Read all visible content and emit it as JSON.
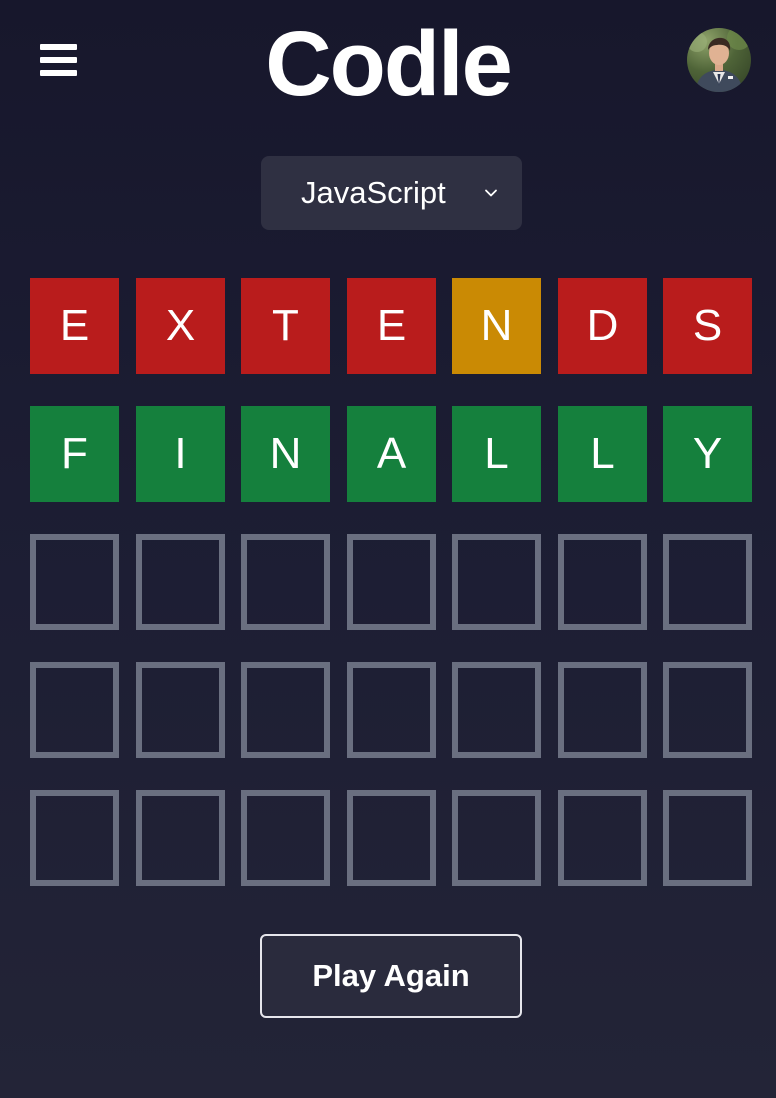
{
  "header": {
    "title": "Codle",
    "menu_icon": "hamburger-menu-icon",
    "avatar_icon": "user-avatar"
  },
  "language_select": {
    "selected": "JavaScript",
    "icon": "chevron-down-icon"
  },
  "colors": {
    "absent": "#b91c1c",
    "present": "#ca8a04",
    "correct": "#15803d",
    "empty_border": "#6a6f80"
  },
  "board": {
    "rows": [
      {
        "status": "guessed",
        "tiles": [
          {
            "letter": "E",
            "state": "absent"
          },
          {
            "letter": "X",
            "state": "absent"
          },
          {
            "letter": "T",
            "state": "absent"
          },
          {
            "letter": "E",
            "state": "absent"
          },
          {
            "letter": "N",
            "state": "present"
          },
          {
            "letter": "D",
            "state": "absent"
          },
          {
            "letter": "S",
            "state": "absent"
          }
        ]
      },
      {
        "status": "guessed",
        "tiles": [
          {
            "letter": "F",
            "state": "correct"
          },
          {
            "letter": "I",
            "state": "correct"
          },
          {
            "letter": "N",
            "state": "correct"
          },
          {
            "letter": "A",
            "state": "correct"
          },
          {
            "letter": "L",
            "state": "correct"
          },
          {
            "letter": "L",
            "state": "correct"
          },
          {
            "letter": "Y",
            "state": "correct"
          }
        ]
      },
      {
        "status": "empty",
        "tiles": [
          {
            "letter": "",
            "state": "empty"
          },
          {
            "letter": "",
            "state": "empty"
          },
          {
            "letter": "",
            "state": "empty"
          },
          {
            "letter": "",
            "state": "empty"
          },
          {
            "letter": "",
            "state": "empty"
          },
          {
            "letter": "",
            "state": "empty"
          },
          {
            "letter": "",
            "state": "empty"
          }
        ]
      },
      {
        "status": "empty",
        "tiles": [
          {
            "letter": "",
            "state": "empty"
          },
          {
            "letter": "",
            "state": "empty"
          },
          {
            "letter": "",
            "state": "empty"
          },
          {
            "letter": "",
            "state": "empty"
          },
          {
            "letter": "",
            "state": "empty"
          },
          {
            "letter": "",
            "state": "empty"
          },
          {
            "letter": "",
            "state": "empty"
          }
        ]
      },
      {
        "status": "empty",
        "tiles": [
          {
            "letter": "",
            "state": "empty"
          },
          {
            "letter": "",
            "state": "empty"
          },
          {
            "letter": "",
            "state": "empty"
          },
          {
            "letter": "",
            "state": "empty"
          },
          {
            "letter": "",
            "state": "empty"
          },
          {
            "letter": "",
            "state": "empty"
          },
          {
            "letter": "",
            "state": "empty"
          }
        ]
      }
    ]
  },
  "actions": {
    "play_again_label": "Play Again"
  }
}
